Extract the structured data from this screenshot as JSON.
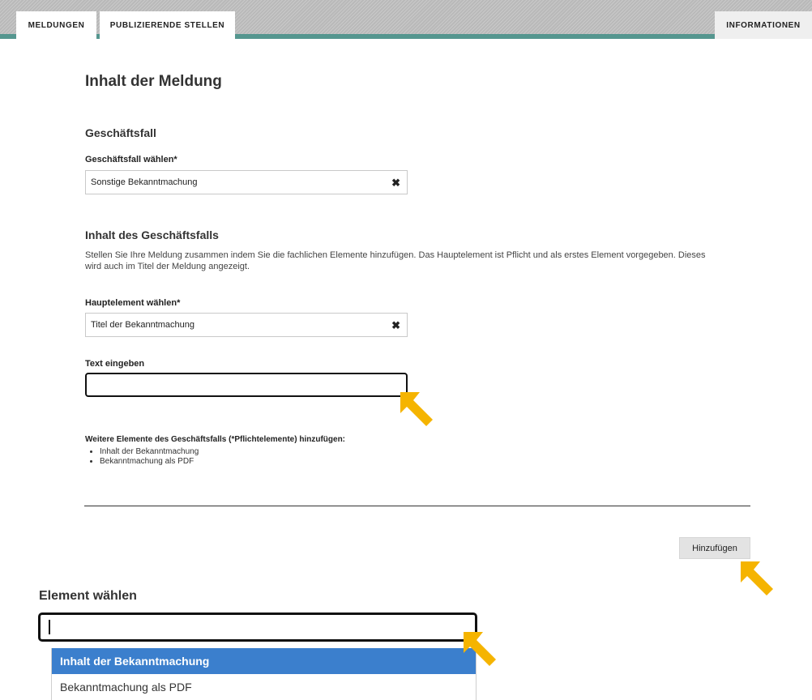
{
  "tabs": {
    "meldungen": "MELDUNGEN",
    "publizierende": "PUBLIZIERENDE STELLEN",
    "informationen": "INFORMATIONEN"
  },
  "form": {
    "title": "Inhalt der Meldung",
    "section_business_case": "Geschäftsfall",
    "business_case_label": "Geschäftsfall wählen*",
    "business_case_value": "Sonstige Bekanntmachung",
    "section_content": "Inhalt des Geschäftsfalls",
    "content_description": "Stellen Sie Ihre Meldung zusammen indem Sie die fachlichen Elemente hinzufügen. Das Hauptelement ist Pflicht und als erstes Element vorgegeben. Dieses wird auch im Titel der Meldung angezeigt.",
    "main_element_label": "Hauptelement wählen*",
    "main_element_value": "Titel der Bekanntmachung",
    "text_label": "Text eingeben",
    "text_value": "",
    "more_elements_label": "Weitere Elemente des Geschäftsfalls (*Pflichtelemente) hinzufügen:",
    "more_elements": [
      "Inhalt der Bekanntmachung",
      "Bekanntmachung als PDF"
    ],
    "clear_symbol": "✖",
    "add_button": "Hinzufügen"
  },
  "element_select": {
    "label": "Element wählen",
    "options": [
      "Inhalt der Bekanntmachung",
      "Bekanntmachung als PDF"
    ],
    "highlighted_option": "Inhalt der Bekanntmachung"
  },
  "colors": {
    "tab_rule": "#55968f",
    "highlight": "#3b7fcd",
    "arrow": "#f5b400"
  },
  "icons": [
    "clear-x-icon",
    "arrow-pointer-icon"
  ]
}
